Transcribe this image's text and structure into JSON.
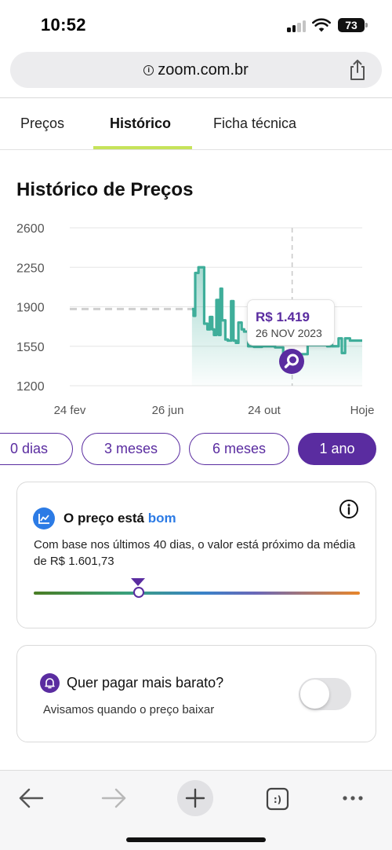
{
  "status_bar": {
    "time": "10:52",
    "battery": "73",
    "icons": [
      "signal-icon",
      "wifi-icon",
      "battery-icon"
    ]
  },
  "browser": {
    "url": "zoom.com.br",
    "lock_glyph": "i",
    "share_icon": "share-icon"
  },
  "tabs": [
    {
      "label": "Preços",
      "active": false
    },
    {
      "label": "Histórico",
      "active": true
    },
    {
      "label": "Ficha técnica",
      "active": false
    }
  ],
  "section_title": "Histórico de Preços",
  "chart_data": {
    "type": "line",
    "title": "",
    "xlabel": "",
    "ylabel": "",
    "ylim": [
      1200,
      2600
    ],
    "y_ticks": [
      "2600",
      "2250",
      "1900",
      "1550",
      "1200"
    ],
    "x_ticks": [
      "24 fev",
      "26 jun",
      "24 out",
      "Hoje"
    ],
    "grid": true,
    "line_color": "#3fae9a",
    "average_line": {
      "value": 1880,
      "style": "dashed",
      "color": "#cfcfcf"
    },
    "series": [
      {
        "points": [
          [
            "26 jul 2023",
            1880
          ],
          [
            "28 jul 2023",
            1820
          ],
          [
            "30 jul 2023",
            2200
          ],
          [
            "3 ago 2023",
            2250
          ],
          [
            "8 ago 2023",
            2250
          ],
          [
            "10 ago 2023",
            1750
          ],
          [
            "14 ago 2023",
            1700
          ],
          [
            "17 ago 2023",
            1810
          ],
          [
            "20 ago 2023",
            1700
          ],
          [
            "22 ago 2023",
            1650
          ],
          [
            "25 ago 2023",
            1960
          ],
          [
            "28 ago 2023",
            1650
          ],
          [
            "30 ago 2023",
            2060
          ],
          [
            "1 set 2023",
            1780
          ],
          [
            "5 set 2023",
            1610
          ],
          [
            "8 set 2023",
            1600
          ],
          [
            "12 set 2023",
            1950
          ],
          [
            "15 set 2023",
            1600
          ],
          [
            "18 set 2023",
            1580
          ],
          [
            "21 set 2023",
            1760
          ],
          [
            "25 set 2023",
            1700
          ],
          [
            "28 set 2023",
            1680
          ],
          [
            "3 out 2023",
            1550
          ],
          [
            "10 out 2023",
            1545
          ],
          [
            "20 out 2023",
            1550
          ],
          [
            "5 nov 2023",
            1540
          ],
          [
            "15 nov 2023",
            1480
          ],
          [
            "26 nov 2023",
            1419
          ],
          [
            "5 dez 2023",
            1480
          ],
          [
            "15 dez 2023",
            1560
          ],
          [
            "28 dez 2023",
            1560
          ],
          [
            "8 jan 2024",
            1550
          ],
          [
            "12 jan 2024",
            1690
          ],
          [
            "14 jan 2024",
            1550
          ],
          [
            "22 jan 2024",
            1620
          ],
          [
            "26 jan 2024",
            1490
          ],
          [
            "30 jan 2024",
            1620
          ],
          [
            "5 fev 2024",
            1600
          ],
          [
            "20 fev 2024",
            1600
          ]
        ]
      }
    ],
    "tooltip": {
      "price": "R$ 1.419",
      "date": "26 NOV 2023",
      "x": "26 nov 2023"
    }
  },
  "periods": [
    {
      "label": "0 dias",
      "active": false
    },
    {
      "label": "3 meses",
      "active": false
    },
    {
      "label": "6 meses",
      "active": false
    },
    {
      "label": "1 ano",
      "active": true
    }
  ],
  "price_card": {
    "heading_prefix": "O preço está",
    "heading_rating": "bom",
    "description": "Com base nos últimos 40 dias, o valor está próximo da média de R$ 1.601,73",
    "scale_position_fraction": 0.32
  },
  "alert_card": {
    "title": "Quer pagar mais barato?",
    "subtitle": "Avisamos quando o preço baixar",
    "toggle_on": false
  },
  "toolbar": {
    "buttons": [
      "back-icon",
      "forward-icon",
      "new-tab-icon",
      "tabs-icon",
      "more-icon"
    ],
    "tabs_glyph": ":)"
  },
  "colors": {
    "brand_purple": "#5a2ca0",
    "tab_accent": "#c6e35a",
    "good_blue": "#2c7be5",
    "line_teal": "#3fae9a"
  }
}
